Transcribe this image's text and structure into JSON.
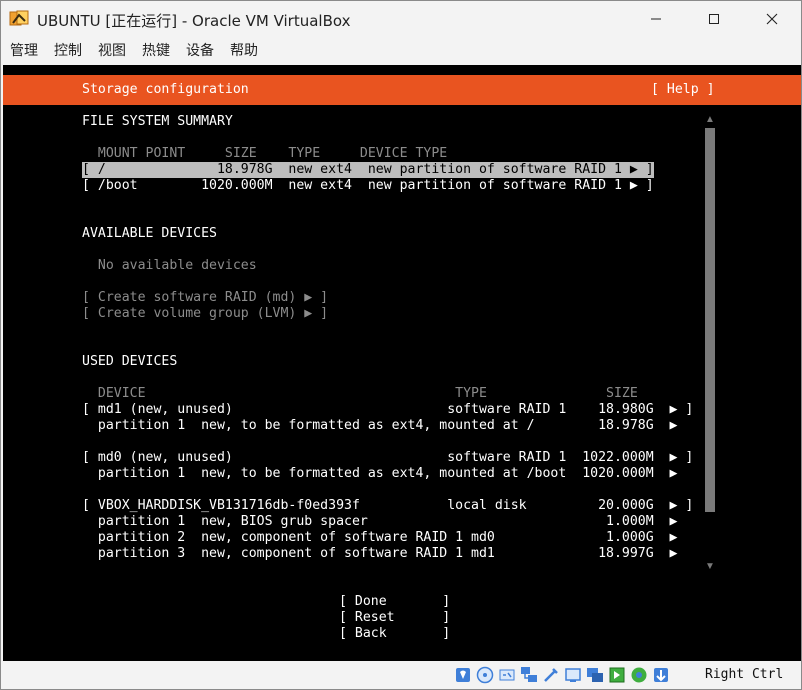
{
  "window": {
    "title": "UBUNTU [正在运行] - Oracle VM VirtualBox"
  },
  "menubar": {
    "items": [
      "管理",
      "控制",
      "视图",
      "热键",
      "设备",
      "帮助"
    ]
  },
  "tui": {
    "header_title": "Storage configuration",
    "help_button": "[ Help ]",
    "fs_summary_heading": "FILE SYSTEM SUMMARY",
    "fs_columns": "  MOUNT POINT     SIZE    TYPE     DEVICE TYPE",
    "fs_rows": [
      "[ /              18.978G  new ext4  new partition of software RAID 1 ▶ ]",
      "[ /boot        1020.000M  new ext4  new partition of software RAID 1 ▶ ]"
    ],
    "available_heading": "AVAILABLE DEVICES",
    "no_available": "  No available devices",
    "create_raid": "[ Create software RAID (md) ▶ ]",
    "create_lvm": "[ Create volume group (LVM) ▶ ]",
    "used_heading": "USED DEVICES",
    "used_columns": "  DEVICE                                       TYPE               SIZE",
    "used_lines": [
      "[ md1 (new, unused)                           software RAID 1    18.980G  ▶ ]",
      "  partition 1  new, to be formatted as ext4, mounted at /        18.978G  ▶",
      "",
      "[ md0 (new, unused)                           software RAID 1  1022.000M  ▶ ]",
      "  partition 1  new, to be formatted as ext4, mounted at /boot  1020.000M  ▶",
      "",
      "[ VBOX_HARDDISK_VB131716db-f0ed393f           local disk         20.000G  ▶ ]",
      "  partition 1  new, BIOS grub spacer                              1.000M  ▶",
      "  partition 2  new, component of software RAID 1 md0              1.000G  ▶",
      "  partition 3  new, component of software RAID 1 md1             18.997G  ▶"
    ],
    "scroll_up": "▲",
    "scroll_down": "▼",
    "buttons": {
      "done": "[ Done       ]",
      "reset": "[ Reset      ]",
      "back": "[ Back       ]"
    }
  },
  "statusbar": {
    "host_key": "Right Ctrl",
    "icons": [
      "hdd-icon",
      "optical-drive-icon",
      "audio-icon",
      "network-icon",
      "usb-icon",
      "shared-folders-icon",
      "display-icon",
      "recording-icon",
      "cpu-icon",
      "mouse-integration-icon",
      "keyboard-icon"
    ]
  }
}
